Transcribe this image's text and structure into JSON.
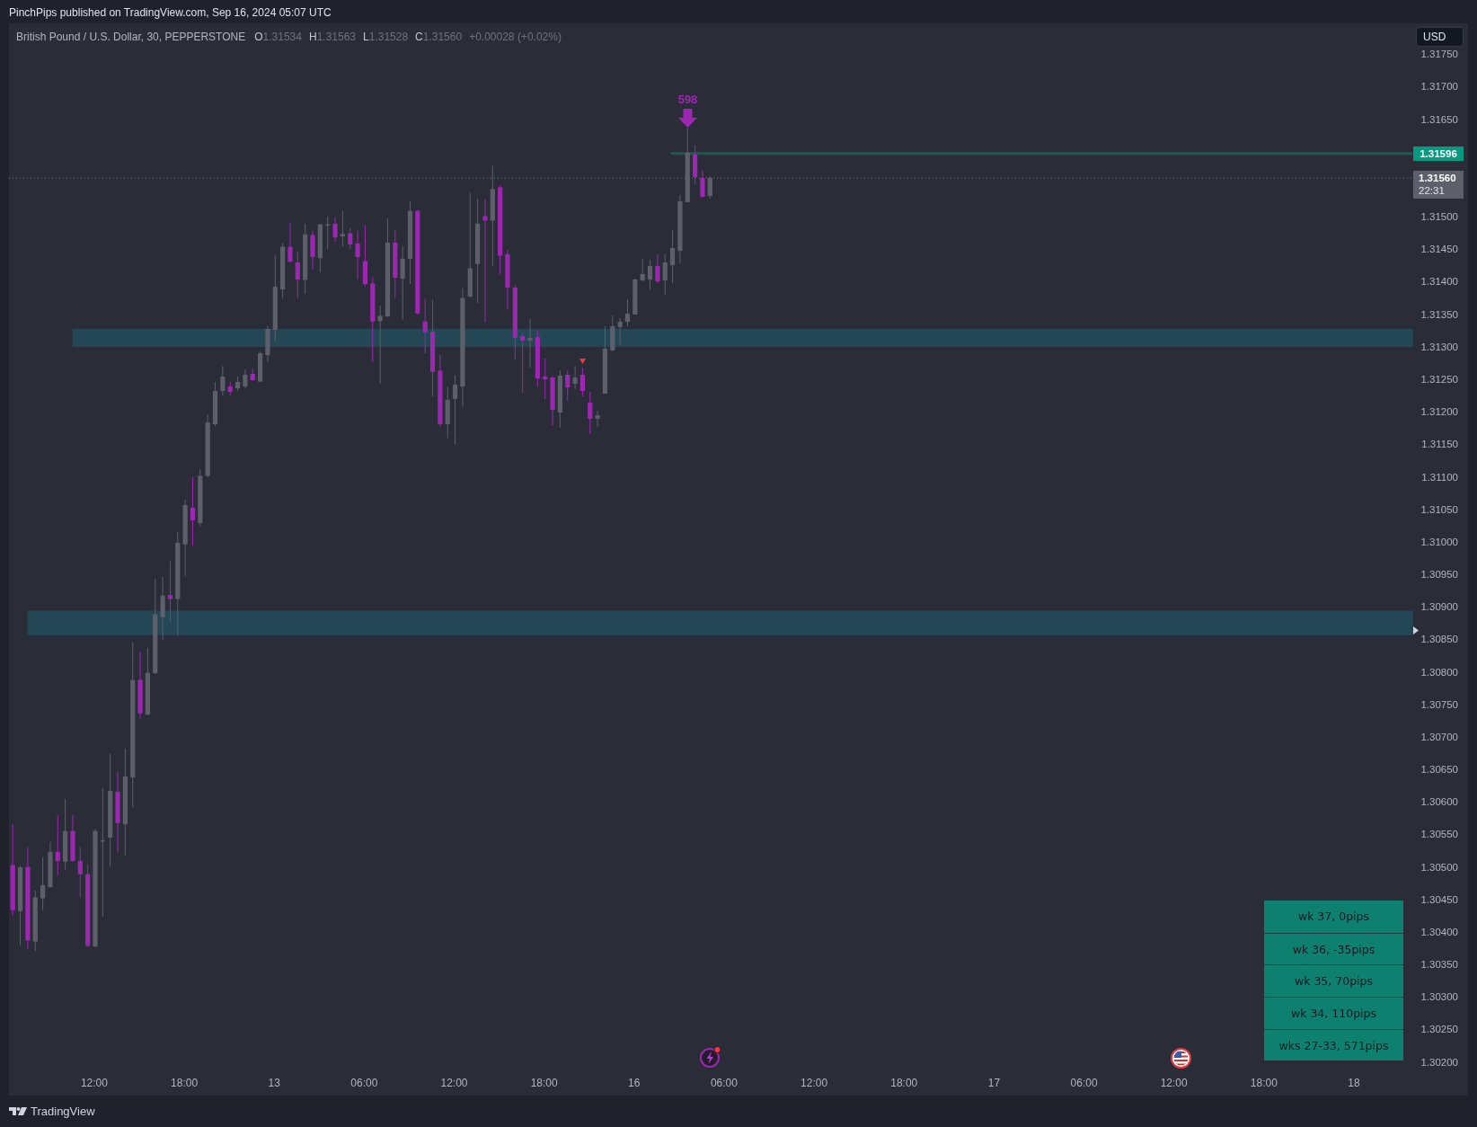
{
  "header": {
    "published": "PinchPips published on TradingView.com, Sep 16, 2024 05:07 UTC"
  },
  "legend": {
    "symbol": "British Pound / U.S. Dollar, 30, PEPPERSTONE",
    "ohlc": [
      {
        "label": "O",
        "value": "1.31534"
      },
      {
        "label": "H",
        "value": "1.31563"
      },
      {
        "label": "L",
        "value": "1.31528"
      },
      {
        "label": "C",
        "value": "1.31560"
      }
    ],
    "change": "+0.00028 (+0.02%)"
  },
  "currency_button": {
    "label": "USD"
  },
  "chart": {
    "signal_marker": {
      "label": "598"
    },
    "level_price_tag": "1.31596",
    "last_price_tag": {
      "price": "1.31560",
      "countdown": "22:31"
    }
  },
  "price_axis": {
    "labels": [
      "1.31750",
      "1.31700",
      "1.31650",
      "1.31500",
      "1.31450",
      "1.31400",
      "1.31350",
      "1.31300",
      "1.31250",
      "1.31200",
      "1.31150",
      "1.31100",
      "1.31050",
      "1.31000",
      "1.30950",
      "1.30900",
      "1.30850",
      "1.30800",
      "1.30750",
      "1.30700",
      "1.30650",
      "1.30600",
      "1.30550",
      "1.30500",
      "1.30450",
      "1.30400",
      "1.30350",
      "1.30300",
      "1.30250",
      "1.30200"
    ]
  },
  "time_axis": {
    "labels": [
      "12:00",
      "18:00",
      "13",
      "06:00",
      "12:00",
      "18:00",
      "16",
      "06:00",
      "12:00",
      "18:00",
      "17",
      "06:00",
      "12:00",
      "18:00",
      "18"
    ]
  },
  "weekly_table": {
    "rows": [
      "wk 37, 0pips",
      "wk 36, -35pips",
      "wk 35, 70pips",
      "wk 34, 110pips",
      "wks 27-33, 571pips"
    ]
  },
  "footer": {
    "brand": "TradingView"
  }
}
